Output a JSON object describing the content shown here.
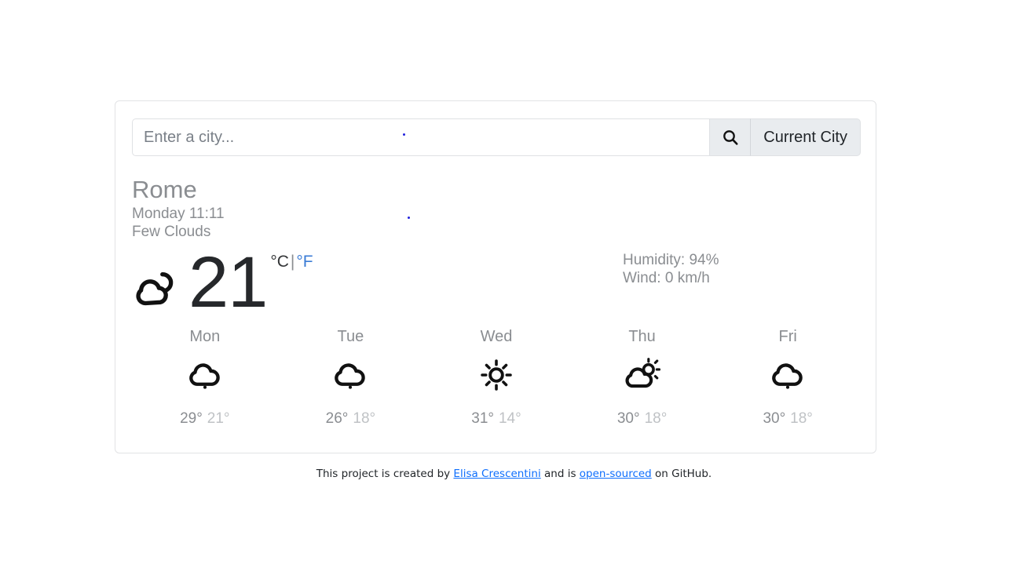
{
  "search": {
    "placeholder": "Enter a city...",
    "value": "",
    "search_icon": "search-icon",
    "current_city_label": "Current City"
  },
  "current": {
    "city": "Rome",
    "datetime": "Monday 11:11",
    "description": "Few Clouds",
    "icon": "sun-behind-cloud-icon",
    "temperature": "21",
    "unit_celsius": "°C",
    "unit_separator": "|",
    "unit_fahrenheit": "°F",
    "humidity": "Humidity: 94%",
    "wind": "Wind: 0 km/h"
  },
  "forecast": {
    "days": [
      {
        "label": "Mon",
        "icon": "cloud-icon",
        "max": "29°",
        "min": "21°"
      },
      {
        "label": "Tue",
        "icon": "cloud-icon",
        "max": "26°",
        "min": "18°"
      },
      {
        "label": "Wed",
        "icon": "sun-icon",
        "max": "31°",
        "min": "14°"
      },
      {
        "label": "Thu",
        "icon": "sun-behind-cloud-icon",
        "max": "30°",
        "min": "18°"
      },
      {
        "label": "Fri",
        "icon": "cloud-icon",
        "max": "30°",
        "min": "18°"
      }
    ]
  },
  "footer": {
    "text_before": "This project is created by ",
    "author_link": "Elisa Crescentini",
    "text_middle": " and is ",
    "source_link": "open-sourced",
    "text_after": " on GitHub."
  },
  "colors": {
    "accent_link": "#0d6efd",
    "unit_active": "#333537",
    "unit_inactive": "#3a7bd5",
    "muted_text": "#8a8d91",
    "card_border": "#e2e3e5",
    "button_bg": "#e9ecef"
  }
}
